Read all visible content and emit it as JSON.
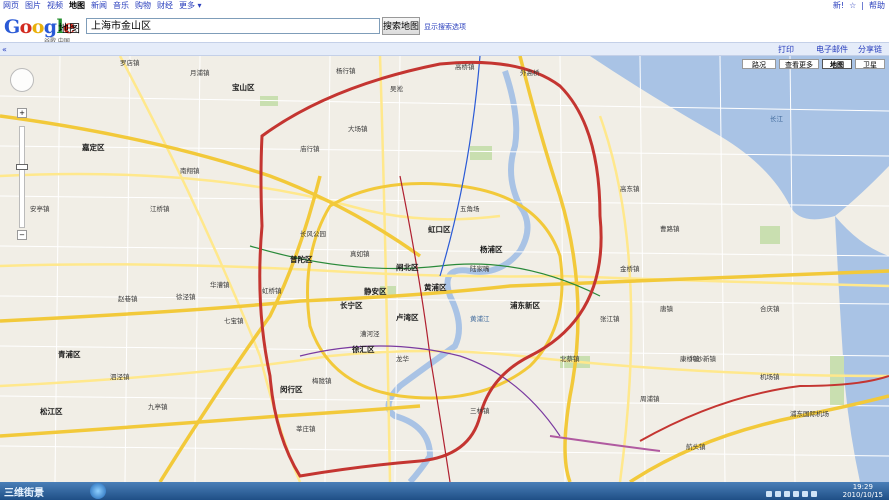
{
  "topnav": {
    "items": [
      "网页",
      "图片",
      "视频",
      "地图",
      "新闻",
      "音乐",
      "购物",
      "财经",
      "更多 ▾"
    ],
    "active_index": 3
  },
  "user": {
    "links": [
      "新!",
      "☆",
      "|",
      "帮助"
    ]
  },
  "logo": {
    "word": "Google",
    "sub": "地图",
    "tag": "谷歌 中国"
  },
  "search": {
    "value": "上海市金山区",
    "button": "搜索地图",
    "options": "显示搜索选项"
  },
  "linkbar": {
    "collapse": "«",
    "print": "打印",
    "email": "电子邮件",
    "link": "分享链接"
  },
  "maptypes": [
    "路况",
    "查看更多",
    "地图",
    "卫星"
  ],
  "maptype_selected": 2,
  "zoom": {
    "in": "+",
    "out": "−"
  },
  "labels": [
    {
      "text": "罗店镇",
      "cls": ""
    },
    {
      "text": "月浦镇",
      "cls": ""
    },
    {
      "text": "杨行镇",
      "cls": ""
    },
    {
      "text": "高桥镇",
      "cls": ""
    },
    {
      "text": "宝山区",
      "cls": "big"
    },
    {
      "text": "吴淞",
      "cls": ""
    },
    {
      "text": "嘉定区",
      "cls": "big"
    },
    {
      "text": "南翔镇",
      "cls": ""
    },
    {
      "text": "江桥镇",
      "cls": ""
    },
    {
      "text": "大场镇",
      "cls": ""
    },
    {
      "text": "庙行镇",
      "cls": ""
    },
    {
      "text": "真如镇",
      "cls": ""
    },
    {
      "text": "长风公园",
      "cls": ""
    },
    {
      "text": "普陀区",
      "cls": "big"
    },
    {
      "text": "闸北区",
      "cls": "big"
    },
    {
      "text": "虹口区",
      "cls": "big"
    },
    {
      "text": "杨浦区",
      "cls": "big"
    },
    {
      "text": "五角场",
      "cls": ""
    },
    {
      "text": "黄浦区",
      "cls": "big"
    },
    {
      "text": "静安区",
      "cls": "big"
    },
    {
      "text": "长宁区",
      "cls": "big"
    },
    {
      "text": "卢湾区",
      "cls": "big"
    },
    {
      "text": "徐汇区",
      "cls": "big"
    },
    {
      "text": "浦东新区",
      "cls": "big"
    },
    {
      "text": "陆家嘴",
      "cls": ""
    },
    {
      "text": "金桥镇",
      "cls": ""
    },
    {
      "text": "张江镇",
      "cls": ""
    },
    {
      "text": "北蔡镇",
      "cls": ""
    },
    {
      "text": "三林镇",
      "cls": ""
    },
    {
      "text": "川沙新镇",
      "cls": ""
    },
    {
      "text": "闵行区",
      "cls": "big"
    },
    {
      "text": "七宝镇",
      "cls": ""
    },
    {
      "text": "虹桥镇",
      "cls": ""
    },
    {
      "text": "华漕镇",
      "cls": ""
    },
    {
      "text": "梅陇镇",
      "cls": ""
    },
    {
      "text": "莘庄镇",
      "cls": ""
    },
    {
      "text": "漕河泾",
      "cls": ""
    },
    {
      "text": "龙华",
      "cls": ""
    },
    {
      "text": "青浦区",
      "cls": "big"
    },
    {
      "text": "徐泾镇",
      "cls": ""
    },
    {
      "text": "赵巷镇",
      "cls": ""
    },
    {
      "text": "松江区",
      "cls": "big"
    },
    {
      "text": "九亭镇",
      "cls": ""
    },
    {
      "text": "泗泾镇",
      "cls": ""
    },
    {
      "text": "安亭镇",
      "cls": ""
    },
    {
      "text": "外高桥",
      "cls": ""
    },
    {
      "text": "高东镇",
      "cls": ""
    },
    {
      "text": "曹路镇",
      "cls": ""
    },
    {
      "text": "唐镇",
      "cls": ""
    },
    {
      "text": "合庆镇",
      "cls": ""
    },
    {
      "text": "机场镇",
      "cls": ""
    },
    {
      "text": "浦东国际机场",
      "cls": ""
    },
    {
      "text": "周浦镇",
      "cls": ""
    },
    {
      "text": "康桥镇",
      "cls": ""
    },
    {
      "text": "航头镇",
      "cls": ""
    },
    {
      "text": "长江",
      "cls": "water"
    },
    {
      "text": "黄浦江",
      "cls": "water"
    }
  ],
  "taskbar": {
    "watermark": "三维街景",
    "time": "19:29",
    "date": "2010/10/15"
  },
  "colors": {
    "ring": "#c43531",
    "expressway": "#f2c93a",
    "arterial": "#ffe88c",
    "water": "#a9c3e5",
    "green": "#c9dfb0"
  }
}
